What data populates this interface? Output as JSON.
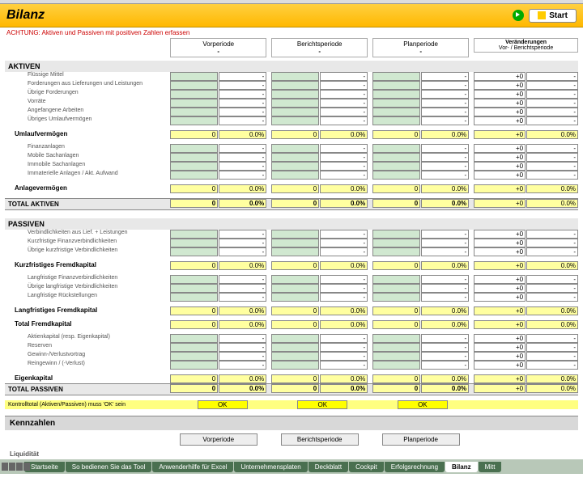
{
  "title": "Bilanz",
  "start": "Start",
  "warning": "ACHTUNG: Aktiven und Passiven mit positiven Zahlen erfassen",
  "periods": [
    "Vorperiode",
    "Berichtsperiode",
    "Planperiode"
  ],
  "changeHead": "Veränderungen\nVor- / Berichtsperiode",
  "aktiven": {
    "label": "AKTIVEN",
    "items1": [
      "Flüssige Mittel",
      "Forderungen aus Lieferungen und Leistungen",
      "Übrige Forderungen",
      "Vorräte",
      "Angefangene Arbeiten",
      "Übriges Umlaufvermögen"
    ],
    "sub1": "Umlaufvermögen",
    "items2": [
      "Finanzanlagen",
      "Mobile Sachanlagen",
      "Immobile Sachanlagen",
      "Immaterielle Anlagen / Akt. Aufwand"
    ],
    "sub2": "Anlagevermögen",
    "total": "TOTAL AKTIVEN"
  },
  "passiven": {
    "label": "PASSIVEN",
    "items1": [
      "Verbindlichkeiten aus Lief. + Leistungen",
      "Kurzfristige Finanzverbindlichkeiten",
      "Übrige kurzfristige Verbindlichkeiten"
    ],
    "sub1": "Kurzfristiges Fremdkapital",
    "items2": [
      "Langfristige Finanzverbindlichkeiten",
      "Übrige langfristige Verbindlichkeiten",
      "Langfristige Rückstellungen"
    ],
    "sub2": "Langfristiges Fremdkapital",
    "subT": "Total Fremdkapital",
    "items3": [
      "Aktienkapital (resp. Eigenkapital)",
      "Reserven",
      "Gewinn-/Verlustvortrag",
      "Reingewinn / (-Verlust)"
    ],
    "sub3": "Eigenkapital",
    "total": "TOTAL PASSIVEN"
  },
  "vals": {
    "zero": "0",
    "pct": "0.0%",
    "dash": "-",
    "plus": "+0"
  },
  "kontrolltext": "Kontrolltotal (Aktiven/Passiven) muss 'OK' sein",
  "ok": "OK",
  "kennzahlen": "Kennzahlen",
  "liq": "Liquidität",
  "tabs": [
    "Startseite",
    "So bedienen Sie das Tool",
    "Anwenderhilfe für Excel",
    "Unternehmensplaten",
    "Deckblatt",
    "Cockpit",
    "Erfolgsrechnung",
    "Bilanz",
    "Mitt"
  ]
}
